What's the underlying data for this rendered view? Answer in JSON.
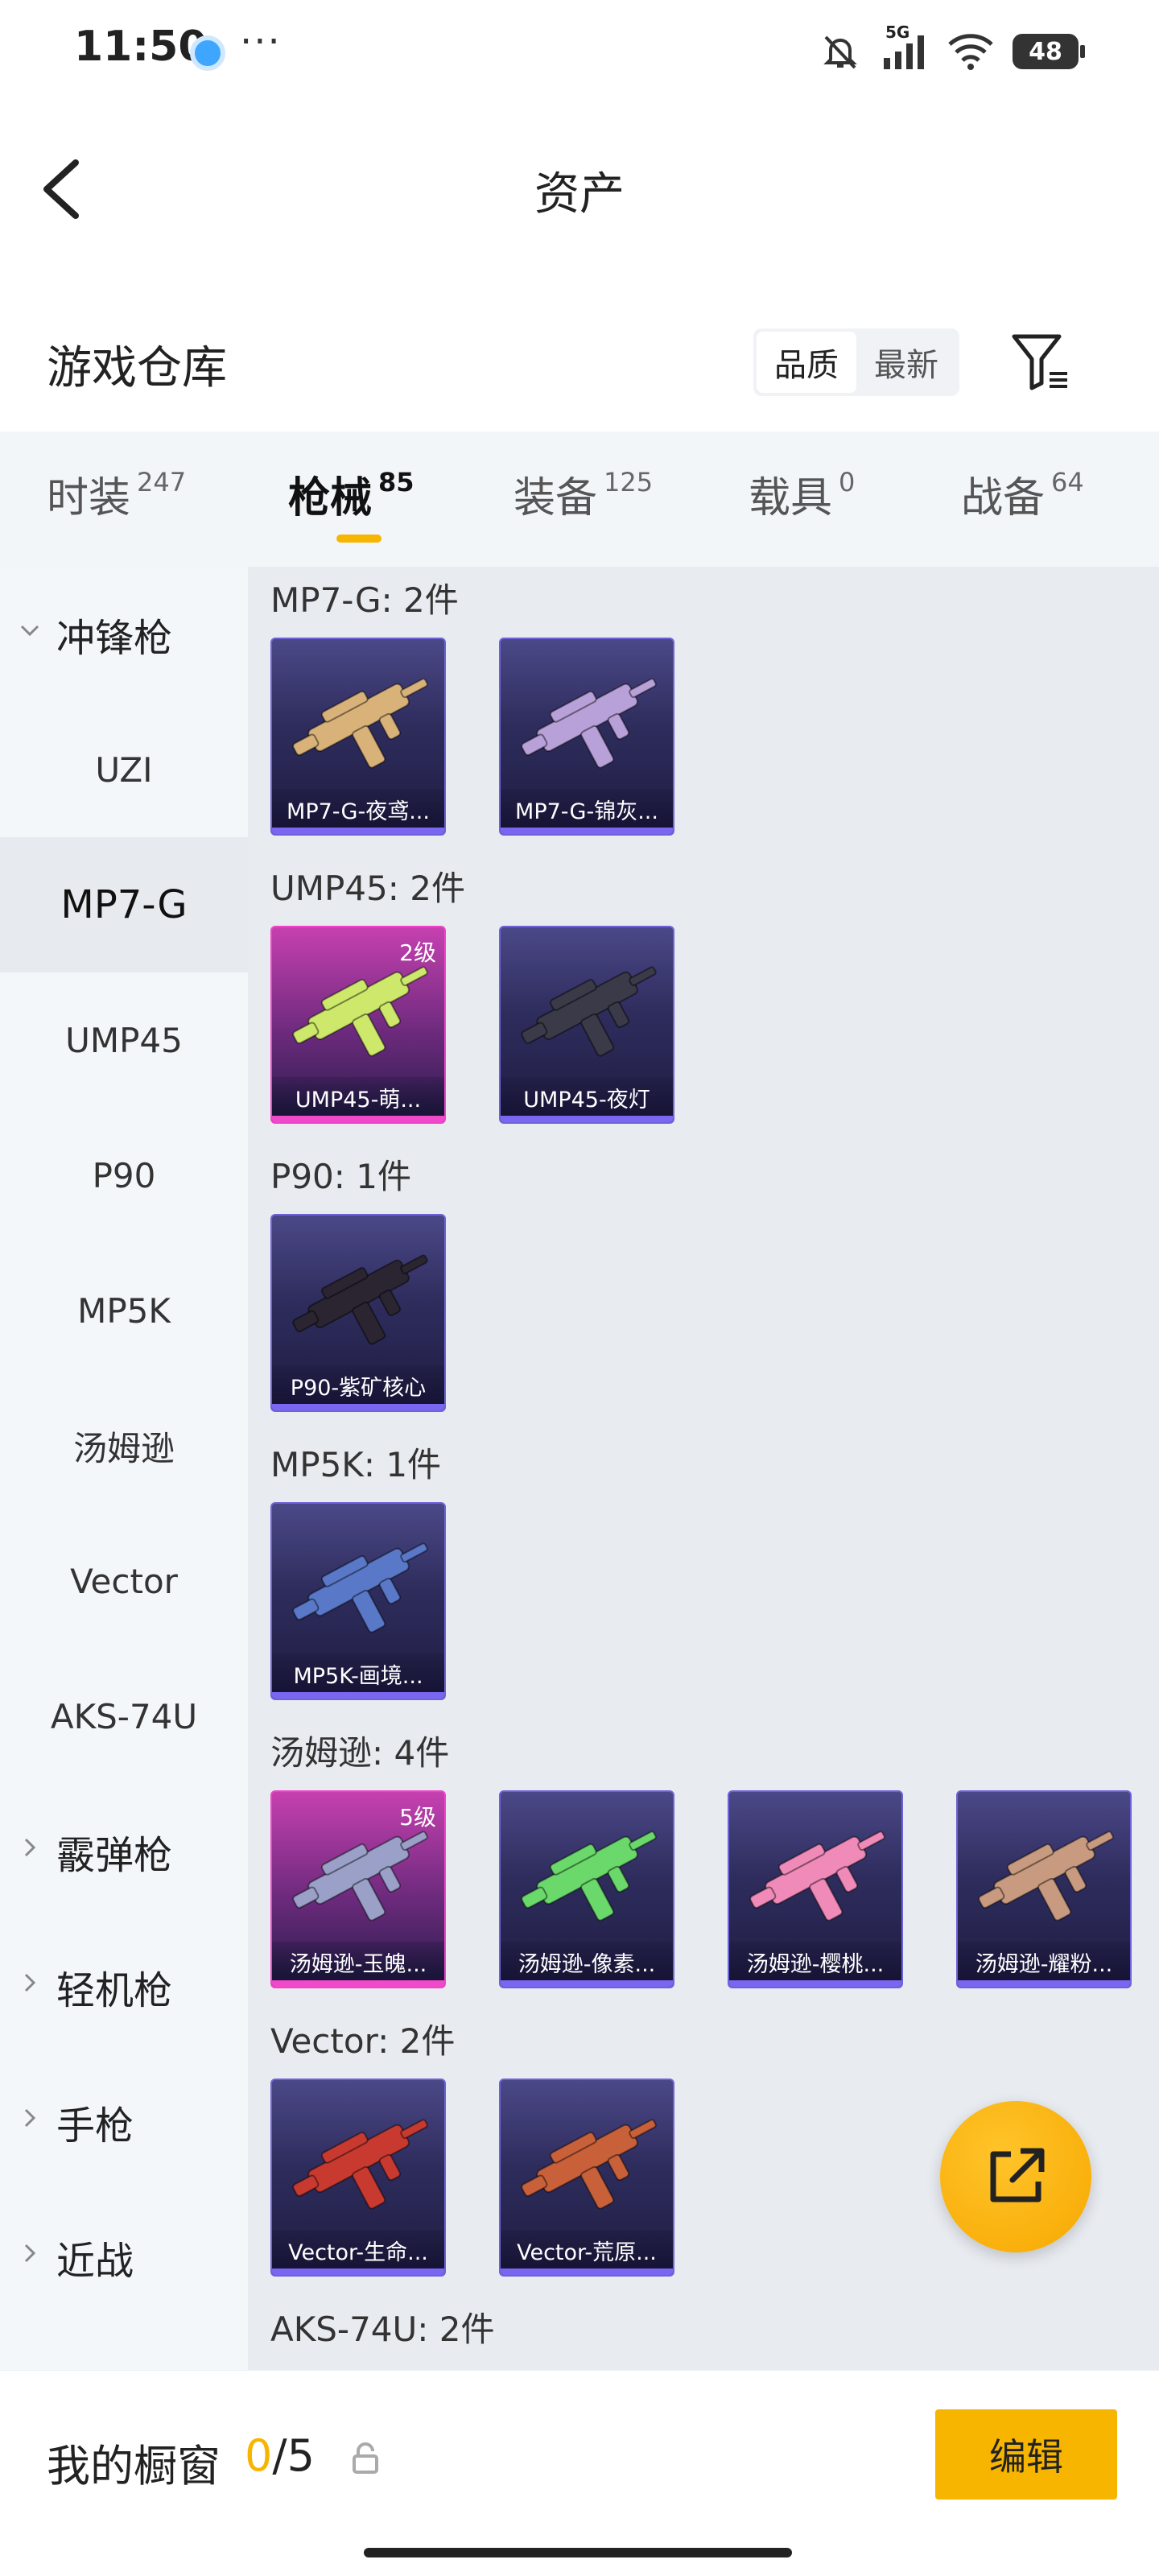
{
  "status_bar": {
    "time": "11:50",
    "more": "···",
    "network": "5G",
    "battery": "48"
  },
  "header": {
    "title": "资产"
  },
  "warehouse": {
    "title": "游戏仓库",
    "sort_options": [
      "品质",
      "最新"
    ],
    "active_sort": "品质"
  },
  "tabs": [
    {
      "label": "时装",
      "count": "247"
    },
    {
      "label": "枪械",
      "count": "85",
      "active": true
    },
    {
      "label": "装备",
      "count": "125"
    },
    {
      "label": "载具",
      "count": "0"
    },
    {
      "label": "战备",
      "count": "64"
    }
  ],
  "sidebar": {
    "items": [
      {
        "label": "冲锋枪",
        "type": "category",
        "expanded": true
      },
      {
        "label": "UZI",
        "type": "sub"
      },
      {
        "label": "MP7-G",
        "type": "sub",
        "selected": true
      },
      {
        "label": "UMP45",
        "type": "sub"
      },
      {
        "label": "P90",
        "type": "sub"
      },
      {
        "label": "MP5K",
        "type": "sub"
      },
      {
        "label": "汤姆逊",
        "type": "sub"
      },
      {
        "label": "Vector",
        "type": "sub"
      },
      {
        "label": "AKS-74U",
        "type": "sub"
      },
      {
        "label": "霰弹枪",
        "type": "category",
        "expanded": false
      },
      {
        "label": "轻机枪",
        "type": "category",
        "expanded": false
      },
      {
        "label": "手枪",
        "type": "category",
        "expanded": false
      },
      {
        "label": "近战",
        "type": "category",
        "expanded": false
      }
    ]
  },
  "groups": [
    {
      "title": "MP7-G: 2件",
      "items": [
        {
          "label": "MP7-G-夜鸢...",
          "rarity": "purple",
          "gun_color": "#d9b27a"
        },
        {
          "label": "MP7-G-锦灰...",
          "rarity": "purple",
          "gun_color": "#b8a0d8"
        }
      ]
    },
    {
      "title": "UMP45: 2件",
      "items": [
        {
          "label": "UMP45-萌...",
          "rarity": "pink",
          "level": "2级",
          "gun_color": "#cde86a"
        },
        {
          "label": "UMP45-夜灯",
          "rarity": "purple",
          "gun_color": "#3a3a48"
        }
      ]
    },
    {
      "title": "P90: 1件",
      "items": [
        {
          "label": "P90-紫矿核心",
          "rarity": "purple",
          "gun_color": "#2a2530"
        }
      ]
    },
    {
      "title": "MP5K: 1件",
      "items": [
        {
          "label": "MP5K-画境...",
          "rarity": "purple",
          "gun_color": "#5a78c8"
        }
      ]
    },
    {
      "title": "汤姆逊: 4件",
      "items": [
        {
          "label": "汤姆逊-玉魄...",
          "rarity": "pink",
          "level": "5级",
          "gun_color": "#9aa0c8"
        },
        {
          "label": "汤姆逊-像素...",
          "rarity": "purple",
          "gun_color": "#6ad86a"
        },
        {
          "label": "汤姆逊-樱桃...",
          "rarity": "purple",
          "gun_color": "#f08ab8"
        },
        {
          "label": "汤姆逊-耀粉...",
          "rarity": "purple",
          "gun_color": "#c89a80"
        }
      ]
    },
    {
      "title": "Vector: 2件",
      "items": [
        {
          "label": "Vector-生命...",
          "rarity": "purple",
          "gun_color": "#c83a30"
        },
        {
          "label": "Vector-荒原...",
          "rarity": "purple",
          "gun_color": "#c8603a"
        }
      ]
    },
    {
      "title": "AKS-74U: 2件",
      "items": []
    }
  ],
  "fab": {
    "icon": "share-external-icon"
  },
  "bottom": {
    "label": "我的橱窗",
    "current": "0",
    "separator": "/",
    "max": "5",
    "edit_label": "编辑"
  },
  "colors": {
    "accent": "#f7b500",
    "purple_card": "#6d63d8",
    "pink_card": "#f044c8"
  }
}
